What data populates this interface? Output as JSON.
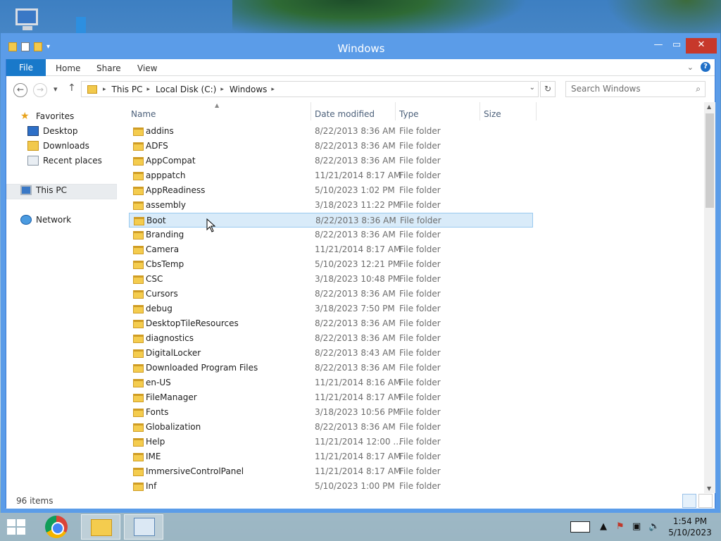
{
  "window": {
    "title": "Windows"
  },
  "ribbon": {
    "tabs": [
      "File",
      "Home",
      "Share",
      "View"
    ]
  },
  "navbar": {
    "breadcrumb": [
      "This PC",
      "Local Disk (C:)",
      "Windows"
    ],
    "search_placeholder": "Search Windows"
  },
  "sidebar": {
    "favorites_label": "Favorites",
    "favorites": [
      "Desktop",
      "Downloads",
      "Recent places"
    ],
    "this_pc": "This PC",
    "network": "Network"
  },
  "columns": {
    "name": "Name",
    "date": "Date modified",
    "type": "Type",
    "size": "Size"
  },
  "files": [
    {
      "name": "addins",
      "date": "8/22/2013 8:36 AM",
      "type": "File folder"
    },
    {
      "name": "ADFS",
      "date": "8/22/2013 8:36 AM",
      "type": "File folder"
    },
    {
      "name": "AppCompat",
      "date": "8/22/2013 8:36 AM",
      "type": "File folder"
    },
    {
      "name": "apppatch",
      "date": "11/21/2014 8:17 AM",
      "type": "File folder"
    },
    {
      "name": "AppReadiness",
      "date": "5/10/2023 1:02 PM",
      "type": "File folder"
    },
    {
      "name": "assembly",
      "date": "3/18/2023 11:22 PM",
      "type": "File folder"
    },
    {
      "name": "Boot",
      "date": "8/22/2013 8:36 AM",
      "type": "File folder"
    },
    {
      "name": "Branding",
      "date": "8/22/2013 8:36 AM",
      "type": "File folder"
    },
    {
      "name": "Camera",
      "date": "11/21/2014 8:17 AM",
      "type": "File folder"
    },
    {
      "name": "CbsTemp",
      "date": "5/10/2023 12:21 PM",
      "type": "File folder"
    },
    {
      "name": "CSC",
      "date": "3/18/2023 10:48 PM",
      "type": "File folder"
    },
    {
      "name": "Cursors",
      "date": "8/22/2013 8:36 AM",
      "type": "File folder"
    },
    {
      "name": "debug",
      "date": "3/18/2023 7:50 PM",
      "type": "File folder"
    },
    {
      "name": "DesktopTileResources",
      "date": "8/22/2013 8:36 AM",
      "type": "File folder"
    },
    {
      "name": "diagnostics",
      "date": "8/22/2013 8:36 AM",
      "type": "File folder"
    },
    {
      "name": "DigitalLocker",
      "date": "8/22/2013 8:43 AM",
      "type": "File folder"
    },
    {
      "name": "Downloaded Program Files",
      "date": "8/22/2013 8:36 AM",
      "type": "File folder"
    },
    {
      "name": "en-US",
      "date": "11/21/2014 8:16 AM",
      "type": "File folder"
    },
    {
      "name": "FileManager",
      "date": "11/21/2014 8:17 AM",
      "type": "File folder"
    },
    {
      "name": "Fonts",
      "date": "3/18/2023 10:56 PM",
      "type": "File folder"
    },
    {
      "name": "Globalization",
      "date": "8/22/2013 8:36 AM",
      "type": "File folder"
    },
    {
      "name": "Help",
      "date": "11/21/2014 12:00 ...",
      "type": "File folder"
    },
    {
      "name": "IME",
      "date": "11/21/2014 8:17 AM",
      "type": "File folder"
    },
    {
      "name": "ImmersiveControlPanel",
      "date": "11/21/2014 8:17 AM",
      "type": "File folder"
    },
    {
      "name": "Inf",
      "date": "5/10/2023 1:00 PM",
      "type": "File folder"
    }
  ],
  "selected_file": "Boot",
  "status": {
    "item_count": "96 items"
  },
  "clock": {
    "time": "1:54 PM",
    "date": "5/10/2023"
  },
  "colors": {
    "accent": "#5b9ce8",
    "file_tab": "#1979ca",
    "close": "#c7382b",
    "selection": "#d9ebf9"
  }
}
